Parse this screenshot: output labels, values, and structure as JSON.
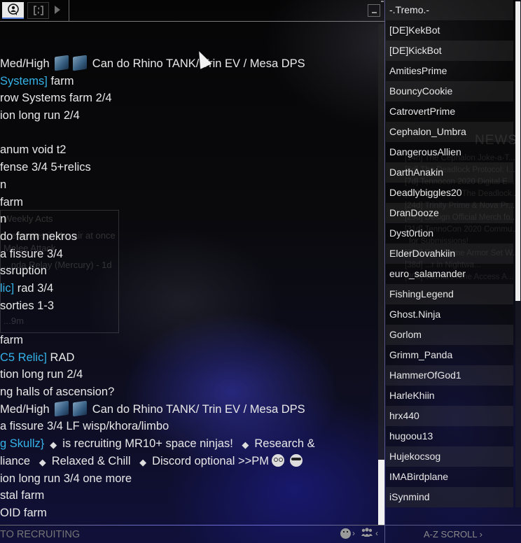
{
  "chat": {
    "tabs": [
      {
        "name": "chat-tab",
        "icon": "speech-person-icon",
        "active": true
      },
      {
        "name": "swap-tab",
        "icon": "bracket-arrows-icon",
        "active": false
      }
    ],
    "messages": [
      {
        "parts": [
          {
            "t": "Med/High "
          },
          {
            "icon": "mastery-rank-icon"
          },
          {
            "icon": "mastery-rank-icon"
          },
          {
            "t": " Can do Rhino TANK/ Trin EV / Mesa DPS"
          }
        ]
      },
      {
        "parts": [
          {
            "link": "Systems]"
          },
          {
            "t": " farm"
          }
        ]
      },
      {
        "parts": [
          {
            "t": "row Systems farm 2/4"
          }
        ]
      },
      {
        "parts": [
          {
            "t": "ion long run 2/4"
          }
        ]
      },
      {
        "parts": [
          {
            "t": ""
          }
        ]
      },
      {
        "parts": [
          {
            "t": "anum void t2"
          }
        ]
      },
      {
        "parts": [
          {
            "t": "fense 3/4 5+relics"
          }
        ]
      },
      {
        "parts": [
          {
            "t": "n"
          }
        ]
      },
      {
        "parts": [
          {
            "t": "farm"
          }
        ]
      },
      {
        "parts": [
          {
            "t": "n"
          }
        ]
      },
      {
        "parts": [
          {
            "t": "do farm nekros"
          }
        ]
      },
      {
        "parts": [
          {
            "t": "a fissure 3/4"
          }
        ]
      },
      {
        "parts": [
          {
            "t": "ssruption"
          }
        ]
      },
      {
        "parts": [
          {
            "link": "lic]"
          },
          {
            "t": "  rad 3/4"
          }
        ]
      },
      {
        "parts": [
          {
            "t": " sorties 1-3"
          }
        ]
      },
      {
        "parts": [
          {
            "t": ""
          }
        ]
      },
      {
        "parts": [
          {
            "t": "farm"
          }
        ]
      },
      {
        "parts": [
          {
            "link": "C5 Relic]"
          },
          {
            "t": " RAD"
          }
        ]
      },
      {
        "parts": [
          {
            "t": "tion long run 2/4"
          }
        ]
      },
      {
        "parts": [
          {
            "t": "ng halls of ascension?"
          }
        ]
      },
      {
        "parts": [
          {
            "t": "Med/High "
          },
          {
            "icon": "mastery-rank-icon"
          },
          {
            "icon": "mastery-rank-icon"
          },
          {
            "t": " Can do Rhino TANK/ Trin EV / Mesa DPS"
          }
        ]
      },
      {
        "parts": [
          {
            "t": "a fissure 3/4 LF wisp/khora/limbo"
          }
        ]
      },
      {
        "parts": [
          {
            "link": "g Skullz}"
          },
          {
            "clan": "clan-emblem-icon"
          },
          {
            "t": "is recruiting MR10+ space ninjas! "
          },
          {
            "clan": "clan-emblem-icon"
          },
          {
            "t": "Research &"
          }
        ]
      },
      {
        "parts": [
          {
            "t": "liance "
          },
          {
            "clan": "clan-emblem-icon"
          },
          {
            "t": "Relaxed & Chill "
          },
          {
            "clan": "clan-emblem-icon"
          },
          {
            "t": "Discord optional >>PM"
          },
          {
            "emoji": "nerd-emoji-icon"
          },
          {
            "emoji": "sunglasses-emoji-icon"
          }
        ]
      },
      {
        "parts": [
          {
            "t": "ion long run 3/4 one more"
          }
        ]
      },
      {
        "parts": [
          {
            "t": "stal farm"
          }
        ]
      },
      {
        "parts": [
          {
            "t": "OID farm"
          }
        ]
      }
    ],
    "input_placeholder": "TO RECRUITING",
    "emoji_chevron": "›",
    "players_chevron": "‹",
    "players_icon": "group-icon"
  },
  "background_ghost": {
    "panel_lines": [
      "Weekly Acts",
      "...enemies in the air at once",
      "Melee Attack",
      "...nda Relay (Mercury) - 1d",
      "...9m"
    ],
    "news_title": "NEWS",
    "news_lines": [
      "[14h] The Cephalon Joke-a-T...",
      "[6d] The Deadlock Protocol: I...",
      "[7d] Tennocon 2020 Digital E...",
      "[8d] Update 28: The Deadlock...",
      "[24d] Trinity Prime & Nova Pr...",
      "[29d] Design Official Merch fo...",
      "[31d] TennoCon 2020 Commu...",
      "for Submissions!",
      "[36d] Free Prime Armor Set W...",
      "[38d] ...r in Nightwa...",
      "[80d] Titania Prime Access A..."
    ]
  },
  "players": {
    "names": [
      "-.Tremo.-",
      "[DE]KekBot",
      "[DE]KickBot",
      "AmitiesPrime",
      "BouncyCookie",
      "CatrovertPrime",
      "Cephalon_Umbra",
      "DangerousAllien",
      "DarthAnakin",
      "Deadlybiggles20",
      "DranDooze",
      "Dyst0rtion",
      "ElderDovahkiin",
      "euro_salamander",
      "FishingLegend",
      "Ghost.Ninja",
      "Gorlom",
      "Grimm_Panda",
      "HammerOfGod1",
      "HarleKhiin",
      "hrx440",
      "hugoou13",
      "Hujekocsog",
      "IMABirdplane",
      "iSynmind"
    ],
    "footer_label": "A-Z SCROLL ›"
  },
  "colors": {
    "link": "#35b3e8",
    "text": "#e8e8e8",
    "accent_divider": "#6c6cd0"
  }
}
